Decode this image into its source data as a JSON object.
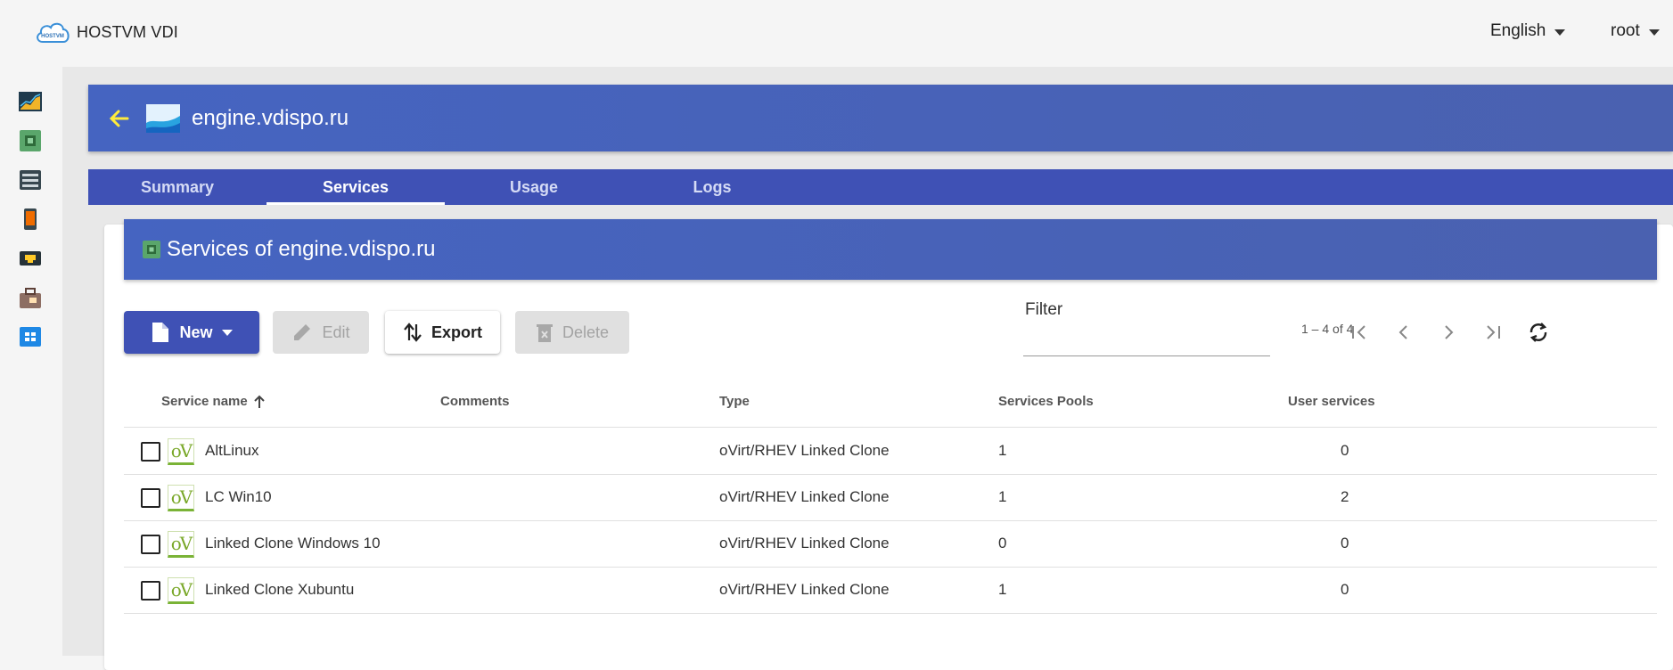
{
  "app": {
    "brand_text": "HOSTVM VDI",
    "language": "English",
    "user": "root",
    "brand_color": "#3f51b5"
  },
  "rail": [
    {
      "icon": "dashboard-chart-icon"
    },
    {
      "icon": "services-chip-icon"
    },
    {
      "icon": "server-icon"
    },
    {
      "icon": "mobile-device-icon"
    },
    {
      "icon": "network-icon"
    },
    {
      "icon": "toolbox-icon"
    },
    {
      "icon": "apps-grid-icon"
    }
  ],
  "header": {
    "title": "engine.vdispo.ru"
  },
  "tabs": [
    {
      "label": "Summary",
      "active": false
    },
    {
      "label": "Services",
      "active": true
    },
    {
      "label": "Usage",
      "active": false
    },
    {
      "label": "Logs",
      "active": false
    }
  ],
  "panel": {
    "title": "Services of engine.vdispo.ru"
  },
  "toolbar": {
    "new_label": "New",
    "edit_label": "Edit",
    "export_label": "Export",
    "delete_label": "Delete"
  },
  "filter": {
    "label": "Filter",
    "value": ""
  },
  "pager": {
    "range": "1 – 4 of 4"
  },
  "table": {
    "columns": [
      "Service name",
      "Comments",
      "Type",
      "Services Pools",
      "User services"
    ],
    "sort_column": "Service name",
    "sort_direction": "ascending",
    "rows": [
      {
        "name": "AltLinux",
        "comments": "",
        "type": "oVirt/RHEV Linked Clone",
        "pools": "1",
        "user_services": "0"
      },
      {
        "name": "LC Win10",
        "comments": "",
        "type": "oVirt/RHEV Linked Clone",
        "pools": "1",
        "user_services": "2"
      },
      {
        "name": "Linked Clone Windows 10",
        "comments": "",
        "type": "oVirt/RHEV Linked Clone",
        "pools": "0",
        "user_services": "0"
      },
      {
        "name": "Linked Clone Xubuntu",
        "comments": "",
        "type": "oVirt/RHEV Linked Clone",
        "pools": "1",
        "user_services": "0"
      }
    ],
    "row_icon_text": "oV"
  }
}
